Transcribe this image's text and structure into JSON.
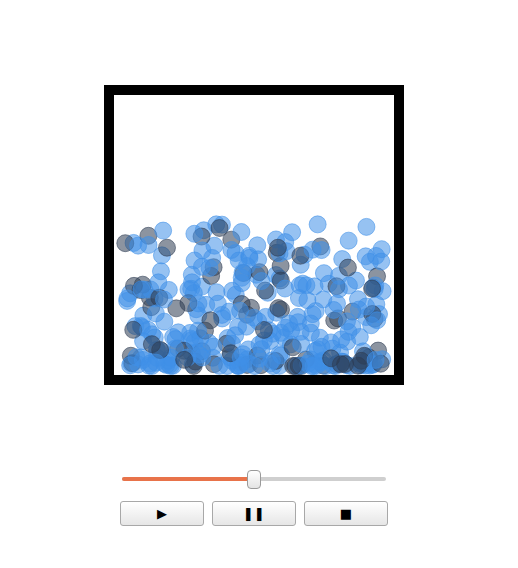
{
  "simulation": {
    "particles": 330,
    "species": [
      {
        "kind": "light",
        "color": "#3f8fe8",
        "share": 0.78
      },
      {
        "kind": "dark",
        "color": "#2d3c52",
        "share": 0.22
      }
    ]
  },
  "slider": {
    "level": 0.5
  },
  "buttons": [
    {
      "label": "▶",
      "name": "play"
    },
    {
      "label": "❚❚",
      "name": "pause"
    },
    {
      "label": "■",
      "name": "stop"
    }
  ]
}
